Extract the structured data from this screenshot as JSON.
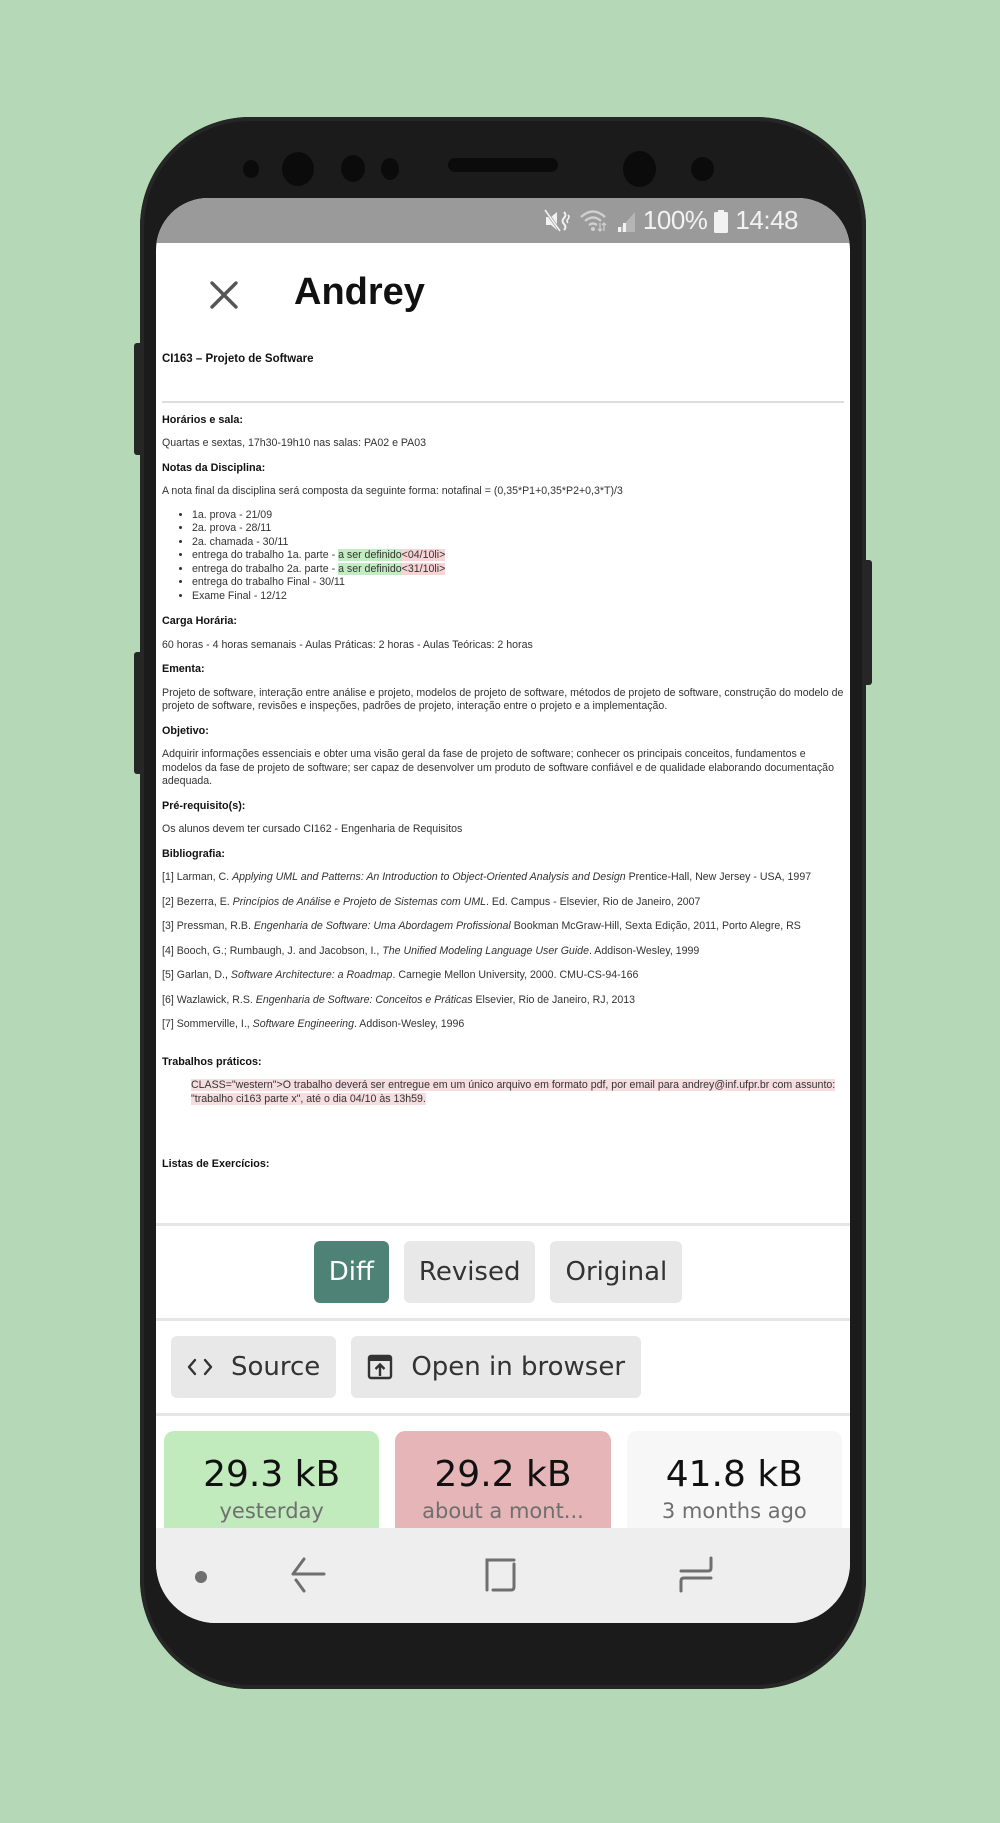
{
  "colors": {
    "background": "#b5d9b6",
    "accent": "#4e8277",
    "inserted": "#c2ecc1",
    "deleted": "#f7d4d6",
    "card_revised": "#c1ebbd",
    "card_original": "#e6b5b8",
    "card_old": "#f7f7f7"
  },
  "statusbar": {
    "icons": [
      "mute-vibrate-icon",
      "wifi-icon",
      "signal-icon",
      "battery-icon"
    ],
    "battery": "100%",
    "time": "14:48"
  },
  "appbar": {
    "title": "Andrey",
    "close_icon": "close-icon"
  },
  "document": {
    "title": "CI163 – Projeto de Software",
    "sections": {
      "horarios": {
        "heading": "Horários e sala:",
        "text": "Quartas e sextas, 17h30-19h10 nas salas: PA02 e PA03"
      },
      "notas": {
        "heading": "Notas da Disciplina:",
        "text": "A nota final da disciplina será composta da seguinte forma: notafinal = (0,35*P1+0,35*P2+0,3*T)/3",
        "items": [
          {
            "text": "1a. prova - 21/09"
          },
          {
            "text": "2a. prova - 28/11"
          },
          {
            "text": "2a. chamada - 30/11"
          },
          {
            "text": "entrega do trabalho 1a. parte - ",
            "inserted": "a ser definido",
            "deleted": "<04/10li>"
          },
          {
            "text": "entrega do trabalho 2a. parte - ",
            "inserted": "a ser definido",
            "deleted": "<31/10li>"
          },
          {
            "text": "entrega do trabalho Final - 30/11"
          },
          {
            "text": "Exame Final - 12/12"
          }
        ]
      },
      "carga": {
        "heading": "Carga Horária:",
        "text": "60 horas - 4 horas semanais - Aulas Práticas: 2 horas - Aulas Teóricas: 2 horas"
      },
      "ementa": {
        "heading": "Ementa:",
        "text": "Projeto de software, interação entre análise e projeto, modelos de projeto de software, métodos de projeto de software, construção do modelo de projeto de software, revisões e inspeções, padrões de projeto, interação entre o projeto e a implementação."
      },
      "objetivo": {
        "heading": "Objetivo:",
        "text": "Adquirir informações essenciais e obter uma visão geral da fase de projeto de software; conhecer os principais conceitos, fundamentos e modelos da fase de projeto de software; ser capaz de desenvolver um produto de software confiável e de qualidade elaborando documentação adequada."
      },
      "prereq": {
        "heading": "Pré-requisito(s):",
        "text": "Os alunos devem ter cursado CI162 - Engenharia de Requisitos"
      },
      "bibliografia": {
        "heading": "Bibliografia:",
        "items": [
          {
            "pre": "[1] Larman, C. ",
            "title": "Applying UML and Patterns: An Introduction to Object-Oriented Analysis and Design",
            "post": " Prentice-Hall, New Jersey - USA, 1997"
          },
          {
            "pre": "[2] Bezerra, E. ",
            "title": "Princípios de Análise e Projeto de Sistemas com UML",
            "post": ". Ed. Campus - Elsevier, Rio de Janeiro, 2007"
          },
          {
            "pre": "[3] Pressman, R.B. ",
            "title": "Engenharia de Software: Uma Abordagem Profissional",
            "post": " Bookman McGraw-Hill, Sexta Edição, 2011, Porto Alegre, RS"
          },
          {
            "pre": "[4] Booch, G.; Rumbaugh, J. and Jacobson, I., ",
            "title": "The Unified Modeling Language User Guide",
            "post": ". Addison-Wesley, 1999"
          },
          {
            "pre": "[5] Garlan, D., ",
            "title": "Software Architecture: a Roadmap",
            "post": ". Carnegie Mellon University, 2000. CMU-CS-94-166"
          },
          {
            "pre": "[6] Wazlawick, R.S. ",
            "title": "Engenharia de Software: Conceitos e Práticas",
            "post": " Elsevier, Rio de Janeiro, RJ, 2013"
          },
          {
            "pre": "[7] Sommerville, I., ",
            "title": "Software Engineering",
            "post": ". Addison-Wesley, 1996"
          }
        ]
      },
      "trabalhos": {
        "heading": "Trabalhos práticos:",
        "deleted_text": "CLASS=\"western\">O trabalho deverá ser entregue em um único arquivo em formato pdf, por email para andrey@inf.ufpr.br com assunto: \"trabalho ci163 parte x\", até o dia 04/10 às 13h59."
      },
      "listas": {
        "heading": "Listas de Exercícios:"
      }
    }
  },
  "view_toggle": {
    "options": [
      "Diff",
      "Revised",
      "Original"
    ],
    "selected": "Diff"
  },
  "actions": {
    "source_label": "Source",
    "source_icon": "code-icon",
    "open_label": "Open in browser",
    "open_icon": "open-in-browser-icon"
  },
  "versions": [
    {
      "size": "29.3 kB",
      "when": "yesterday",
      "state": "revised"
    },
    {
      "size": "29.2 kB",
      "when": "about a mont...",
      "state": "original"
    },
    {
      "size": "41.8 kB",
      "when": "3 months ago",
      "state": "older"
    }
  ],
  "navbar": {
    "items": [
      "dot-indicator-icon",
      "back-icon",
      "home-icon",
      "recents-icon"
    ]
  }
}
